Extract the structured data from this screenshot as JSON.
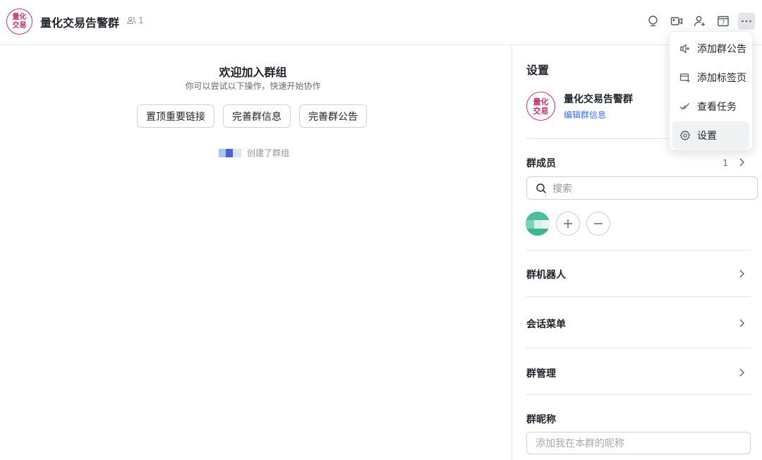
{
  "header": {
    "logo_line1": "量化",
    "logo_line2": "交易",
    "title": "量化交易告警群",
    "member_count": "1",
    "tools": [
      "search-icon",
      "video-icon",
      "add-member-icon",
      "calendar-icon",
      "more-icon"
    ],
    "calendar_day": "7"
  },
  "welcome": {
    "title": "欢迎加入群组",
    "subtitle": "你可以尝试以下操作，快速开始协作",
    "actions": [
      "置顶重要链接",
      "完善群信息",
      "完善群公告"
    ],
    "created_text": "创建了群组"
  },
  "settings": {
    "title": "设置",
    "group_name": "量化交易告警群",
    "edit_link": "编辑群信息",
    "members_label": "群成员",
    "members_count": "1",
    "search_placeholder": "搜索",
    "bots_label": "群机器人",
    "menu_label": "会话菜单",
    "manage_label": "群管理",
    "nickname_label": "群昵称",
    "nickname_placeholder": "添加我在本群的昵称"
  },
  "dropdown": {
    "items": [
      "添加群公告",
      "添加标签页",
      "查看任务",
      "设置"
    ]
  },
  "colors": {
    "brand": "#c8336f",
    "link": "#3370ff"
  }
}
